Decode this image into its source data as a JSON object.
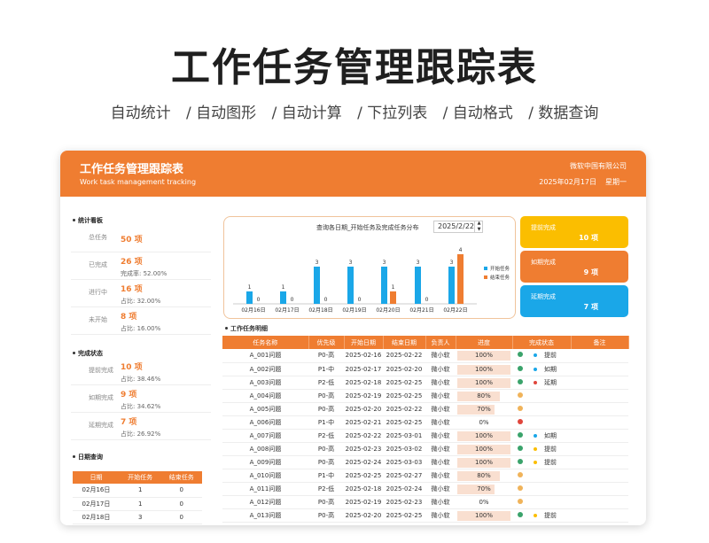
{
  "hero": {
    "title": "工作任务管理跟踪表",
    "tags": [
      "自动统计",
      "/ 自动图形",
      "/ 自动计算",
      "/ 下拉列表",
      "/ 自动格式",
      "/ 数据查询"
    ]
  },
  "header": {
    "title": "工作任务管理跟踪表",
    "subtitle": "Work task management tracking",
    "company": "微软中国有限公司",
    "date": "2025年02月17日",
    "weekday": "星期一"
  },
  "colors": {
    "accent": "#ef7d31",
    "blue": "#1aa7e8",
    "yellow": "#fbbe00",
    "green": "#3aa36b",
    "red": "#e0463c"
  },
  "stats": {
    "title": "统计看板",
    "rows": [
      {
        "label": "总任务",
        "value": "50 项",
        "pct": ""
      },
      {
        "label": "已完成",
        "value": "26 项",
        "pct": "完成率:  52.00%"
      },
      {
        "label": "进行中",
        "value": "16 项",
        "pct": "占比:  32.00%"
      },
      {
        "label": "未开始",
        "value": "8 项",
        "pct": "占比:  16.00%"
      }
    ]
  },
  "completion": {
    "title": "完成状态",
    "rows": [
      {
        "label": "提前完成",
        "value": "10 项",
        "pct": "占比:  38.46%"
      },
      {
        "label": "如期完成",
        "value": "9 项",
        "pct": "占比:  34.62%"
      },
      {
        "label": "延期完成",
        "value": "7 项",
        "pct": "占比:  26.92%"
      }
    ]
  },
  "date_query": {
    "title": "日期查询",
    "headers": [
      "日期",
      "开始任务",
      "结束任务"
    ],
    "rows": [
      [
        "02月16日",
        "1",
        "0"
      ],
      [
        "02月17日",
        "1",
        "0"
      ],
      [
        "02月18日",
        "3",
        "0"
      ]
    ]
  },
  "chart_data": {
    "type": "bar",
    "title": "查询各日期_开始任务及完成任务分布",
    "query_date": "2025/2/22",
    "categories": [
      "02月16日",
      "02月17日",
      "02月18日",
      "02月19日",
      "02月20日",
      "02月21日",
      "02月22日"
    ],
    "series": [
      {
        "name": "开始任务",
        "color": "#1aa7e8",
        "values": [
          1,
          1,
          3,
          3,
          3,
          3,
          3
        ]
      },
      {
        "name": "结束任务",
        "color": "#ef7d31",
        "values": [
          0,
          0,
          0,
          0,
          1,
          0,
          4
        ]
      }
    ],
    "ylim": [
      0,
      4
    ],
    "legend": "right"
  },
  "kpis": [
    {
      "label": "提前完成",
      "value": "10 项",
      "color": "#fbbe00"
    },
    {
      "label": "如期完成",
      "value": "9 项",
      "color": "#ef7d31"
    },
    {
      "label": "延期完成",
      "value": "7 项",
      "color": "#1aa7e8"
    }
  ],
  "detail": {
    "title": "工作任务明细",
    "headers": [
      "任务名称",
      "优先级",
      "开始日期",
      "结束日期",
      "负责人",
      "进度",
      "完成状态",
      "备注"
    ],
    "rows": [
      {
        "name": "A_001问题",
        "priority": "P0-高",
        "start": "2025-02-16",
        "end": "2025-02-22",
        "owner": "微小软",
        "progress": 1.0,
        "progress_text": "100%",
        "status_color": "#3aa36b",
        "mark_color": "#1aa7e8",
        "note": "提前"
      },
      {
        "name": "A_002问题",
        "priority": "P1-中",
        "start": "2025-02-17",
        "end": "2025-02-20",
        "owner": "微小软",
        "progress": 1.0,
        "progress_text": "100%",
        "status_color": "#3aa36b",
        "mark_color": "#1aa7e8",
        "note": "如期"
      },
      {
        "name": "A_003问题",
        "priority": "P2-低",
        "start": "2025-02-18",
        "end": "2025-02-25",
        "owner": "微小软",
        "progress": 1.0,
        "progress_text": "100%",
        "status_color": "#3aa36b",
        "mark_color": "#e0463c",
        "note": "延期"
      },
      {
        "name": "A_004问题",
        "priority": "P0-高",
        "start": "2025-02-19",
        "end": "2025-02-25",
        "owner": "微小软",
        "progress": 0.8,
        "progress_text": "80%",
        "status_color": "#f0b35a",
        "mark_color": "",
        "note": ""
      },
      {
        "name": "A_005问题",
        "priority": "P0-高",
        "start": "2025-02-20",
        "end": "2025-02-22",
        "owner": "微小软",
        "progress": 0.7,
        "progress_text": "70%",
        "status_color": "#f0b35a",
        "mark_color": "",
        "note": ""
      },
      {
        "name": "A_006问题",
        "priority": "P1-中",
        "start": "2025-02-21",
        "end": "2025-02-25",
        "owner": "微小软",
        "progress": 0.0,
        "progress_text": "0%",
        "status_color": "#e0463c",
        "mark_color": "",
        "note": ""
      },
      {
        "name": "A_007问题",
        "priority": "P2-低",
        "start": "2025-02-22",
        "end": "2025-03-01",
        "owner": "微小软",
        "progress": 1.0,
        "progress_text": "100%",
        "status_color": "#3aa36b",
        "mark_color": "#1aa7e8",
        "note": "如期"
      },
      {
        "name": "A_008问题",
        "priority": "P0-高",
        "start": "2025-02-23",
        "end": "2025-03-02",
        "owner": "微小软",
        "progress": 1.0,
        "progress_text": "100%",
        "status_color": "#3aa36b",
        "mark_color": "#fbbe00",
        "note": "提前"
      },
      {
        "name": "A_009问题",
        "priority": "P0-高",
        "start": "2025-02-24",
        "end": "2025-03-03",
        "owner": "微小软",
        "progress": 1.0,
        "progress_text": "100%",
        "status_color": "#3aa36b",
        "mark_color": "#fbbe00",
        "note": "提前"
      },
      {
        "name": "A_010问题",
        "priority": "P1-中",
        "start": "2025-02-25",
        "end": "2025-02-27",
        "owner": "微小软",
        "progress": 0.8,
        "progress_text": "80%",
        "status_color": "#f0b35a",
        "mark_color": "",
        "note": ""
      },
      {
        "name": "A_011问题",
        "priority": "P2-低",
        "start": "2025-02-18",
        "end": "2025-02-24",
        "owner": "微小软",
        "progress": 0.7,
        "progress_text": "70%",
        "status_color": "#f0b35a",
        "mark_color": "",
        "note": ""
      },
      {
        "name": "A_012问题",
        "priority": "P0-高",
        "start": "2025-02-19",
        "end": "2025-02-23",
        "owner": "微小软",
        "progress": 0.0,
        "progress_text": "0%",
        "status_color": "#f0b35a",
        "mark_color": "",
        "note": ""
      },
      {
        "name": "A_013问题",
        "priority": "P0-高",
        "start": "2025-02-20",
        "end": "2025-02-25",
        "owner": "微小软",
        "progress": 1.0,
        "progress_text": "100%",
        "status_color": "#3aa36b",
        "mark_color": "#fbbe00",
        "note": "提前"
      }
    ]
  }
}
